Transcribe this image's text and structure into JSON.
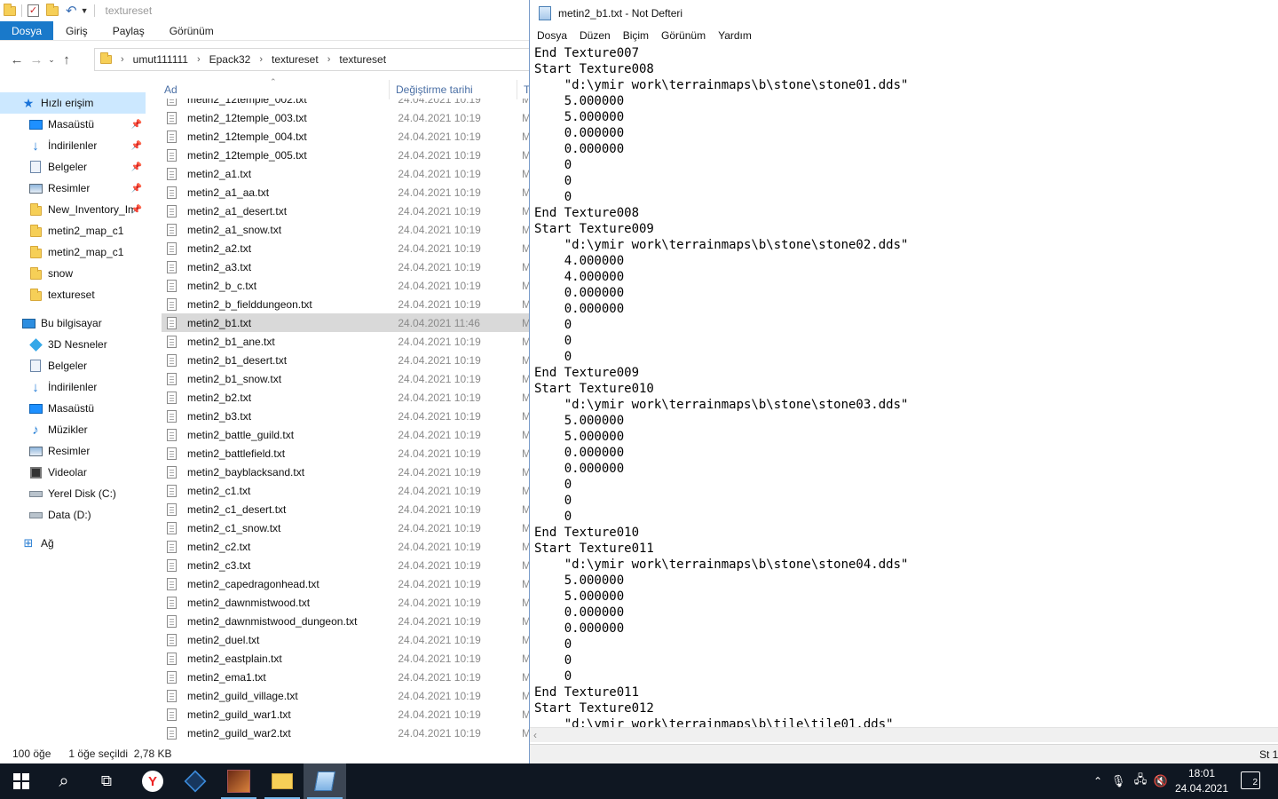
{
  "explorer": {
    "title": "textureset",
    "ribbon_tabs": [
      "Dosya",
      "Giriş",
      "Paylaş",
      "Görünüm"
    ],
    "breadcrumbs": [
      "umut111111",
      "Epack32",
      "textureset",
      "textureset"
    ],
    "nav_items": [
      {
        "label": "Hızlı erişim",
        "icon": "star-icon",
        "indent": 0,
        "selected": true
      },
      {
        "label": "Masaüstü",
        "icon": "desktop-icon",
        "indent": 1,
        "pinned": true
      },
      {
        "label": "İndirilenler",
        "icon": "download-icon",
        "indent": 1,
        "pinned": true
      },
      {
        "label": "Belgeler",
        "icon": "documents-icon",
        "indent": 1,
        "pinned": true
      },
      {
        "label": "Resimler",
        "icon": "pictures-icon",
        "indent": 1,
        "pinned": true
      },
      {
        "label": "New_Inventory_Im",
        "icon": "folder-icon",
        "indent": 1,
        "pinned": true
      },
      {
        "label": "metin2_map_c1",
        "icon": "folder-icon",
        "indent": 1
      },
      {
        "label": "metin2_map_c1",
        "icon": "folder-icon",
        "indent": 1
      },
      {
        "label": "snow",
        "icon": "folder-icon",
        "indent": 1
      },
      {
        "label": "textureset",
        "icon": "folder-icon",
        "indent": 1
      },
      {
        "label": "Bu bilgisayar",
        "icon": "computer-icon",
        "indent": 0,
        "gap": true
      },
      {
        "label": "3D Nesneler",
        "icon": "3d-objects-icon",
        "indent": 1
      },
      {
        "label": "Belgeler",
        "icon": "documents-icon",
        "indent": 1
      },
      {
        "label": "İndirilenler",
        "icon": "download-icon",
        "indent": 1
      },
      {
        "label": "Masaüstü",
        "icon": "desktop-icon",
        "indent": 1
      },
      {
        "label": "Müzikler",
        "icon": "music-icon",
        "indent": 1
      },
      {
        "label": "Resimler",
        "icon": "pictures-icon",
        "indent": 1
      },
      {
        "label": "Videolar",
        "icon": "videos-icon",
        "indent": 1
      },
      {
        "label": "Yerel Disk (C:)",
        "icon": "drive-icon",
        "indent": 1
      },
      {
        "label": "Data (D:)",
        "icon": "drive-icon",
        "indent": 1
      },
      {
        "label": "Ağ",
        "icon": "network-icon",
        "indent": 0,
        "gap": true
      }
    ],
    "columns": {
      "name": "Ad",
      "date": "Değiştirme tarihi",
      "type": "T"
    },
    "files": [
      {
        "name": "metin2_12temple_002.txt",
        "date": "24.04.2021 10:19",
        "type": "M"
      },
      {
        "name": "metin2_12temple_003.txt",
        "date": "24.04.2021 10:19",
        "type": "M"
      },
      {
        "name": "metin2_12temple_004.txt",
        "date": "24.04.2021 10:19",
        "type": "M"
      },
      {
        "name": "metin2_12temple_005.txt",
        "date": "24.04.2021 10:19",
        "type": "M"
      },
      {
        "name": "metin2_a1.txt",
        "date": "24.04.2021 10:19",
        "type": "M"
      },
      {
        "name": "metin2_a1_aa.txt",
        "date": "24.04.2021 10:19",
        "type": "M"
      },
      {
        "name": "metin2_a1_desert.txt",
        "date": "24.04.2021 10:19",
        "type": "M"
      },
      {
        "name": "metin2_a1_snow.txt",
        "date": "24.04.2021 10:19",
        "type": "M"
      },
      {
        "name": "metin2_a2.txt",
        "date": "24.04.2021 10:19",
        "type": "M"
      },
      {
        "name": "metin2_a3.txt",
        "date": "24.04.2021 10:19",
        "type": "M"
      },
      {
        "name": "metin2_b_c.txt",
        "date": "24.04.2021 10:19",
        "type": "M"
      },
      {
        "name": "metin2_b_fielddungeon.txt",
        "date": "24.04.2021 10:19",
        "type": "M"
      },
      {
        "name": "metin2_b1.txt",
        "date": "24.04.2021 11:46",
        "type": "M",
        "selected": true
      },
      {
        "name": "metin2_b1_ane.txt",
        "date": "24.04.2021 10:19",
        "type": "M"
      },
      {
        "name": "metin2_b1_desert.txt",
        "date": "24.04.2021 10:19",
        "type": "M"
      },
      {
        "name": "metin2_b1_snow.txt",
        "date": "24.04.2021 10:19",
        "type": "M"
      },
      {
        "name": "metin2_b2.txt",
        "date": "24.04.2021 10:19",
        "type": "M"
      },
      {
        "name": "metin2_b3.txt",
        "date": "24.04.2021 10:19",
        "type": "M"
      },
      {
        "name": "metin2_battle_guild.txt",
        "date": "24.04.2021 10:19",
        "type": "M"
      },
      {
        "name": "metin2_battlefield.txt",
        "date": "24.04.2021 10:19",
        "type": "M"
      },
      {
        "name": "metin2_bayblacksand.txt",
        "date": "24.04.2021 10:19",
        "type": "M"
      },
      {
        "name": "metin2_c1.txt",
        "date": "24.04.2021 10:19",
        "type": "M"
      },
      {
        "name": "metin2_c1_desert.txt",
        "date": "24.04.2021 10:19",
        "type": "M"
      },
      {
        "name": "metin2_c1_snow.txt",
        "date": "24.04.2021 10:19",
        "type": "M"
      },
      {
        "name": "metin2_c2.txt",
        "date": "24.04.2021 10:19",
        "type": "M"
      },
      {
        "name": "metin2_c3.txt",
        "date": "24.04.2021 10:19",
        "type": "M"
      },
      {
        "name": "metin2_capedragonhead.txt",
        "date": "24.04.2021 10:19",
        "type": "M"
      },
      {
        "name": "metin2_dawnmistwood.txt",
        "date": "24.04.2021 10:19",
        "type": "M"
      },
      {
        "name": "metin2_dawnmistwood_dungeon.txt",
        "date": "24.04.2021 10:19",
        "type": "M"
      },
      {
        "name": "metin2_duel.txt",
        "date": "24.04.2021 10:19",
        "type": "M"
      },
      {
        "name": "metin2_eastplain.txt",
        "date": "24.04.2021 10:19",
        "type": "M"
      },
      {
        "name": "metin2_ema1.txt",
        "date": "24.04.2021 10:19",
        "type": "M"
      },
      {
        "name": "metin2_guild_village.txt",
        "date": "24.04.2021 10:19",
        "type": "M"
      },
      {
        "name": "metin2_guild_war1.txt",
        "date": "24.04.2021 10:19",
        "type": "M"
      },
      {
        "name": "metin2_guild_war2.txt",
        "date": "24.04.2021 10:19",
        "type": "M"
      }
    ],
    "status": {
      "count": "100 öğe",
      "selection": "1 öğe seçildi  2,78 KB"
    }
  },
  "notepad": {
    "title": "metin2_b1.txt - Not Defteri",
    "menu": [
      "Dosya",
      "Düzen",
      "Biçim",
      "Görünüm",
      "Yardım"
    ],
    "lines": [
      "End Texture007",
      "Start Texture008",
      "    \"d:\\ymir work\\terrainmaps\\b\\stone\\stone01.dds\"",
      "    5.000000",
      "    5.000000",
      "    0.000000",
      "    0.000000",
      "    0",
      "    0",
      "    0",
      "End Texture008",
      "Start Texture009",
      "    \"d:\\ymir work\\terrainmaps\\b\\stone\\stone02.dds\"",
      "    4.000000",
      "    4.000000",
      "    0.000000",
      "    0.000000",
      "    0",
      "    0",
      "    0",
      "End Texture009",
      "Start Texture010",
      "    \"d:\\ymir work\\terrainmaps\\b\\stone\\stone03.dds\"",
      "    5.000000",
      "    5.000000",
      "    0.000000",
      "    0.000000",
      "    0",
      "    0",
      "    0",
      "End Texture010",
      "Start Texture011",
      "    \"d:\\ymir work\\terrainmaps\\b\\stone\\stone04.dds\"",
      "    5.000000",
      "    5.000000",
      "    0.000000",
      "    0.000000",
      "    0",
      "    0",
      "    0",
      "End Texture011",
      "Start Texture012",
      "    \"d:\\ymir work\\terrainmaps\\b\\tile\\tile01.dds\""
    ],
    "status_position": "St 1"
  },
  "taskbar": {
    "time": "18:01",
    "date": "24.04.2021",
    "notification_count": "2",
    "apps": [
      {
        "name": "start-button",
        "icon": "windows-icon"
      },
      {
        "name": "search-button",
        "icon": "search-icon",
        "glyph": "⌕"
      },
      {
        "name": "task-view-button",
        "icon": "task-view-icon",
        "glyph": "⧉"
      },
      {
        "name": "yandex-browser-button",
        "icon": "yandex-icon",
        "glyph": "Y"
      },
      {
        "name": "virtualbox-button",
        "icon": "virtualbox-icon"
      },
      {
        "name": "game-app-button",
        "icon": "game-icon"
      },
      {
        "name": "file-explorer-button",
        "icon": "folder-icon"
      },
      {
        "name": "notepad-button",
        "icon": "notepad-icon"
      }
    ]
  }
}
